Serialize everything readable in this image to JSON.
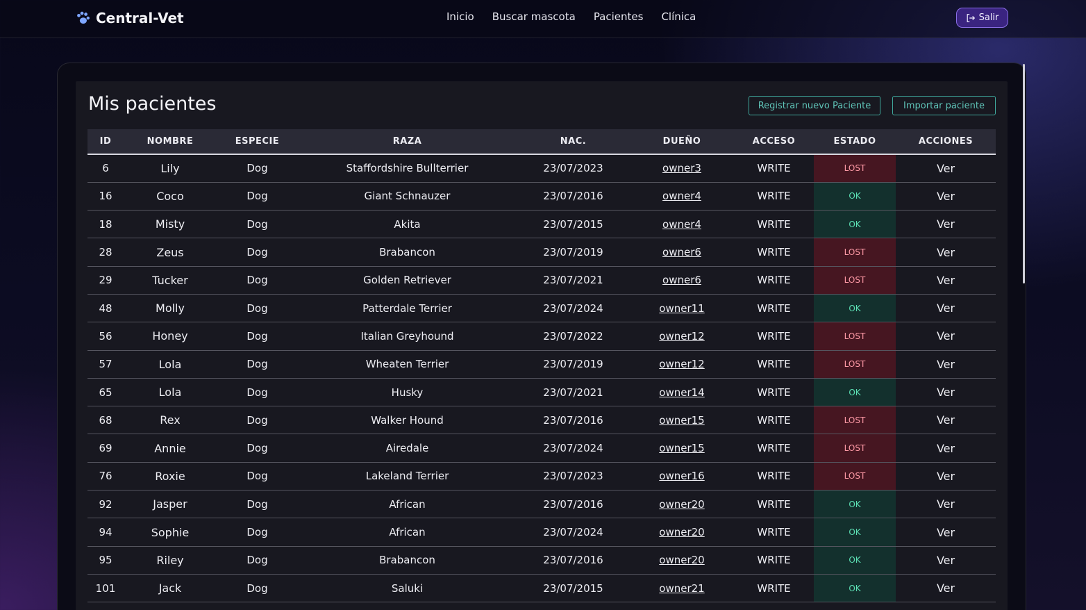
{
  "brand": {
    "name": "Central-Vet",
    "icon": "paw-icon"
  },
  "nav": {
    "links": [
      "Inicio",
      "Buscar mascota",
      "Pacientes",
      "Clínica"
    ],
    "logout_label": "Salir",
    "logout_icon": "logout-icon"
  },
  "page": {
    "title": "Mis pacientes",
    "register_label": "Registrar nuevo Paciente",
    "import_label": "Importar paciente"
  },
  "table": {
    "headers": [
      "ID",
      "NOMBRE",
      "ESPECIE",
      "RAZA",
      "NAC.",
      "DUEÑO",
      "ACCESO",
      "ESTADO",
      "ACCIONES"
    ],
    "rows": [
      {
        "id": "6",
        "name": "Lily",
        "species": "Dog",
        "breed": "Staffordshire Bullterrier",
        "birth": "23/07/2023",
        "owner": "owner3",
        "access": "WRITE",
        "status": "LOST",
        "action": "Ver"
      },
      {
        "id": "16",
        "name": "Coco",
        "species": "Dog",
        "breed": "Giant Schnauzer",
        "birth": "23/07/2016",
        "owner": "owner4",
        "access": "WRITE",
        "status": "OK",
        "action": "Ver"
      },
      {
        "id": "18",
        "name": "Misty",
        "species": "Dog",
        "breed": "Akita",
        "birth": "23/07/2015",
        "owner": "owner4",
        "access": "WRITE",
        "status": "OK",
        "action": "Ver"
      },
      {
        "id": "28",
        "name": "Zeus",
        "species": "Dog",
        "breed": "Brabancon",
        "birth": "23/07/2019",
        "owner": "owner6",
        "access": "WRITE",
        "status": "LOST",
        "action": "Ver"
      },
      {
        "id": "29",
        "name": "Tucker",
        "species": "Dog",
        "breed": "Golden Retriever",
        "birth": "23/07/2021",
        "owner": "owner6",
        "access": "WRITE",
        "status": "LOST",
        "action": "Ver"
      },
      {
        "id": "48",
        "name": "Molly",
        "species": "Dog",
        "breed": "Patterdale Terrier",
        "birth": "23/07/2024",
        "owner": "owner11",
        "access": "WRITE",
        "status": "OK",
        "action": "Ver"
      },
      {
        "id": "56",
        "name": "Honey",
        "species": "Dog",
        "breed": "Italian Greyhound",
        "birth": "23/07/2022",
        "owner": "owner12",
        "access": "WRITE",
        "status": "LOST",
        "action": "Ver"
      },
      {
        "id": "57",
        "name": "Lola",
        "species": "Dog",
        "breed": "Wheaten Terrier",
        "birth": "23/07/2019",
        "owner": "owner12",
        "access": "WRITE",
        "status": "LOST",
        "action": "Ver"
      },
      {
        "id": "65",
        "name": "Lola",
        "species": "Dog",
        "breed": "Husky",
        "birth": "23/07/2021",
        "owner": "owner14",
        "access": "WRITE",
        "status": "OK",
        "action": "Ver"
      },
      {
        "id": "68",
        "name": "Rex",
        "species": "Dog",
        "breed": "Walker Hound",
        "birth": "23/07/2016",
        "owner": "owner15",
        "access": "WRITE",
        "status": "LOST",
        "action": "Ver"
      },
      {
        "id": "69",
        "name": "Annie",
        "species": "Dog",
        "breed": "Airedale",
        "birth": "23/07/2024",
        "owner": "owner15",
        "access": "WRITE",
        "status": "LOST",
        "action": "Ver"
      },
      {
        "id": "76",
        "name": "Roxie",
        "species": "Dog",
        "breed": "Lakeland Terrier",
        "birth": "23/07/2023",
        "owner": "owner16",
        "access": "WRITE",
        "status": "LOST",
        "action": "Ver"
      },
      {
        "id": "92",
        "name": "Jasper",
        "species": "Dog",
        "breed": "African",
        "birth": "23/07/2016",
        "owner": "owner20",
        "access": "WRITE",
        "status": "OK",
        "action": "Ver"
      },
      {
        "id": "94",
        "name": "Sophie",
        "species": "Dog",
        "breed": "African",
        "birth": "23/07/2024",
        "owner": "owner20",
        "access": "WRITE",
        "status": "OK",
        "action": "Ver"
      },
      {
        "id": "95",
        "name": "Riley",
        "species": "Dog",
        "breed": "Brabancon",
        "birth": "23/07/2016",
        "owner": "owner20",
        "access": "WRITE",
        "status": "OK",
        "action": "Ver"
      },
      {
        "id": "101",
        "name": "Jack",
        "species": "Dog",
        "breed": "Saluki",
        "birth": "23/07/2015",
        "owner": "owner21",
        "access": "WRITE",
        "status": "OK",
        "action": "Ver"
      }
    ]
  },
  "colors": {
    "accent": "#3a2480",
    "teal": "#3fa89c",
    "lost": "#ff9aa6",
    "ok": "#5ce0b4"
  }
}
